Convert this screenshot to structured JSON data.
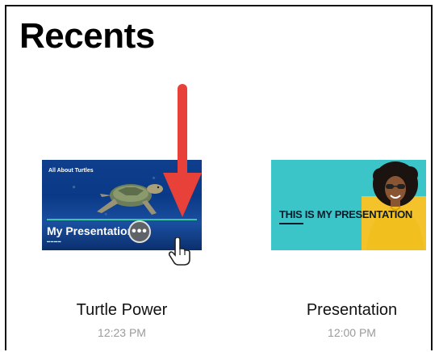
{
  "header": {
    "title": "Recents"
  },
  "files": [
    {
      "name": "Turtle Power",
      "time": "12:23 PM",
      "thumbnail": {
        "eyebrow": "All About Turtles",
        "title": "My Presentation"
      },
      "more_button_label": "•••"
    },
    {
      "name": "Presentation",
      "time": "12:00 PM",
      "thumbnail": {
        "title": "THIS IS MY PRESENTATION"
      }
    }
  ],
  "colors": {
    "arrow": "#e8413a",
    "turtle_bg": "#0e3e8c",
    "pres_bg": "#3cc5c9",
    "pres_accent": "#f4c32c",
    "time_text": "#9a9a9a"
  }
}
